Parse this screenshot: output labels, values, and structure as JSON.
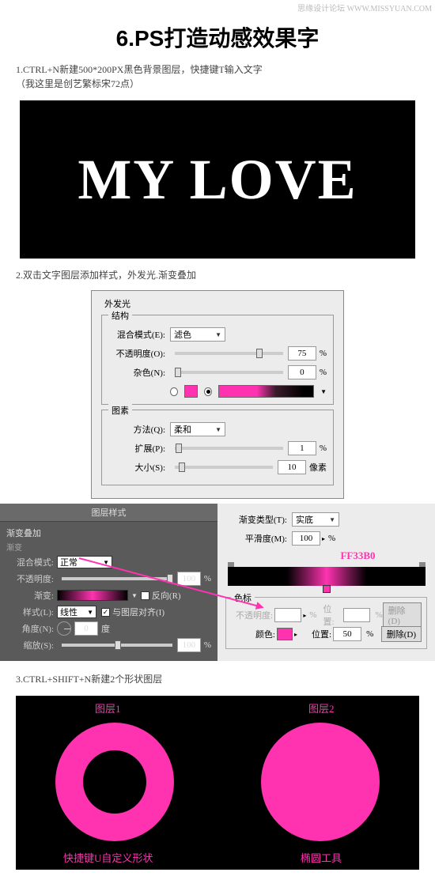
{
  "watermark": "思缘设计论坛 WWW.MISSYUAN.COM",
  "title": "6.PS打造动感效果字",
  "step1": {
    "line1": "1.CTRL+N新建500*200PX黑色背景图层，快捷键T输入文字",
    "line2": "（我这里是创艺繁标宋72点）",
    "text": "MY LOVE"
  },
  "step2": {
    "line": "2.双击文字图层添加样式，外发光.渐变叠加",
    "outer_glow_title": "外发光",
    "structure_title": "结构",
    "blend_mode_label": "混合模式(E):",
    "blend_mode_value": "滤色",
    "opacity_label": "不透明度(O):",
    "opacity_value": "75",
    "noise_label": "杂色(N):",
    "noise_value": "0",
    "elements_title": "图素",
    "method_label": "方法(Q):",
    "method_value": "柔和",
    "spread_label": "扩展(P):",
    "spread_value": "1",
    "size_label": "大小(S):",
    "size_value": "10",
    "pixels": "像素",
    "percent": "%"
  },
  "layer_style": {
    "title": "图层样式",
    "section1": "渐变叠加",
    "section2": "渐变",
    "blend_mode_label": "混合模式:",
    "blend_mode_value": "正常",
    "opacity_label": "不透明度:",
    "opacity_value": "100",
    "gradient_label": "渐变:",
    "reverse_label": "反向(R)",
    "style_label": "样式(L):",
    "style_value": "线性",
    "align_label": "与图层对齐(I)",
    "angle_label": "角度(N):",
    "angle_value": "0",
    "angle_unit": "度",
    "scale_label": "缩放(S):",
    "scale_value": "100"
  },
  "grad_editor": {
    "type_label": "渐变类型(T):",
    "type_value": "实底",
    "smooth_label": "平滑度(M):",
    "smooth_value": "100",
    "hex": "FF33B0",
    "stops_title": "色标",
    "stop_opacity_label": "不透明度:",
    "stop_pos_label": "位置:",
    "color_label": "颜色:",
    "pos_value": "50",
    "delete_btn": "删除(D)"
  },
  "step3": {
    "line": "3.CTRL+SHIFT+N新建2个形状图层",
    "layer1": "图层1",
    "layer2": "图层2",
    "caption1": "快捷键U自定义形状",
    "caption2": "椭圆工具"
  }
}
